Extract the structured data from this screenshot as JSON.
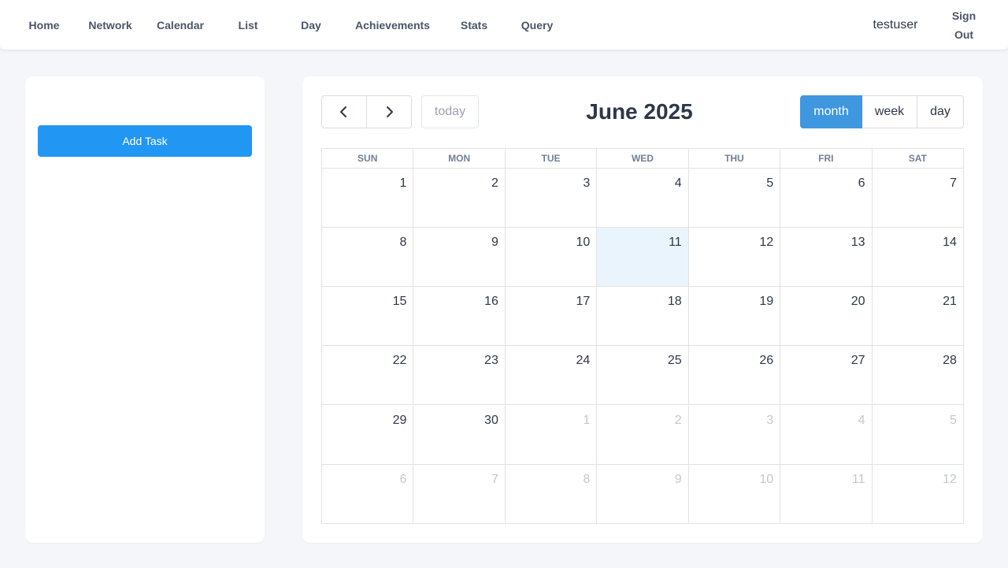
{
  "nav": {
    "links": [
      "Home",
      "Network",
      "Calendar",
      "List",
      "Day",
      "Achievements",
      "Stats",
      "Query"
    ],
    "username": "testuser",
    "signout": "Sign Out"
  },
  "sidebar": {
    "add_task_label": "Add Task"
  },
  "calendar": {
    "title": "June 2025",
    "today_label": "today",
    "views": {
      "month": "month",
      "week": "week",
      "day": "day"
    },
    "active_view": "month",
    "weekdays": [
      "SUN",
      "MON",
      "TUE",
      "WED",
      "THU",
      "FRI",
      "SAT"
    ],
    "weeks": [
      [
        "1",
        "2",
        "3",
        "4",
        "5",
        "6",
        "7"
      ],
      [
        "8",
        "9",
        "10",
        "11",
        "12",
        "13",
        "14"
      ],
      [
        "15",
        "16",
        "17",
        "18",
        "19",
        "20",
        "21"
      ],
      [
        "22",
        "23",
        "24",
        "25",
        "26",
        "27",
        "28"
      ],
      [
        "29",
        "30",
        "1",
        "2",
        "3",
        "4",
        "5"
      ],
      [
        "6",
        "7",
        "8",
        "9",
        "10",
        "11",
        "12"
      ]
    ],
    "today": "11",
    "colors": {
      "accent": "#3f97e0",
      "add_button": "#2196f3",
      "today_bg": "#eaf4fc"
    }
  }
}
